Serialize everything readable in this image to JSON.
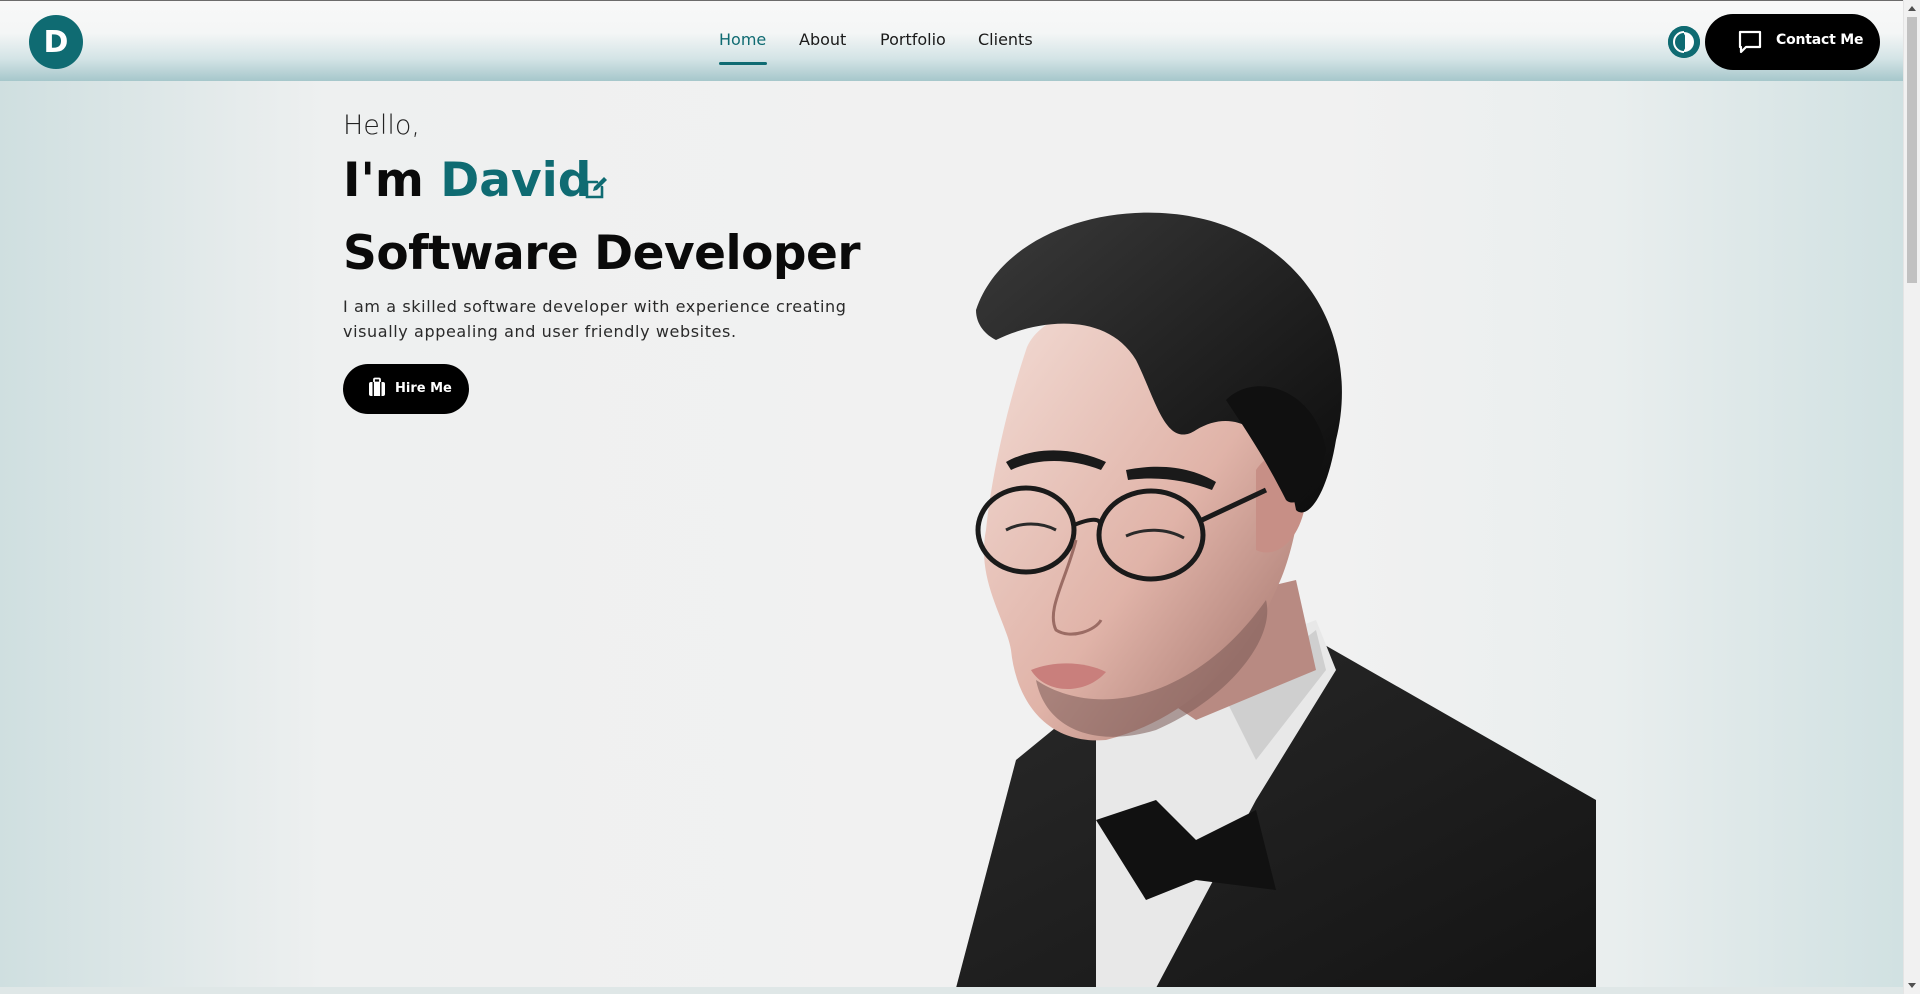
{
  "header": {
    "logo_letter": "D",
    "nav": [
      {
        "label": "Home",
        "active": true
      },
      {
        "label": "About",
        "active": false
      },
      {
        "label": "Portfolio",
        "active": false
      },
      {
        "label": "Clients",
        "active": false
      }
    ],
    "contact_label": "Contact Me"
  },
  "hero": {
    "greeting": "Hello,",
    "name_prefix": "I'm",
    "name": "David",
    "role": "Software Developer",
    "bio": "I am a skilled software developer with experience creating visually appealing and user friendly websites.",
    "hire_label": "Hire Me"
  },
  "colors": {
    "accent": "#0f6b72",
    "button": "#000000",
    "background": "#f1f1f1"
  },
  "icons": {
    "edit": "pencil-square-icon",
    "contact": "chat-bubble-icon",
    "hire": "briefcase-icon",
    "theme": "half-circle-toggle-icon"
  }
}
